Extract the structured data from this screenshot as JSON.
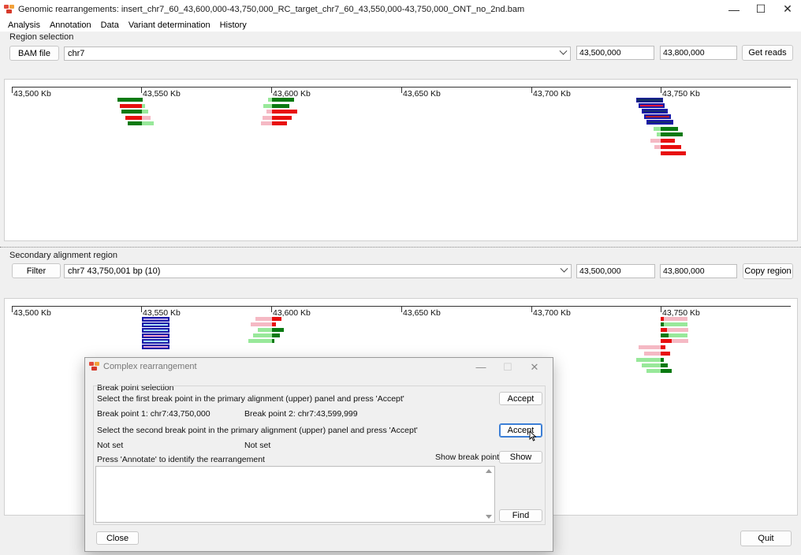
{
  "window": {
    "title": "Genomic rearrangements: insert_chr7_60_43,600,000-43,750,000_RC_target_chr7_60_43,550,000-43,750,000_ONT_no_2nd.bam",
    "minimize": "—",
    "maximize": "☐",
    "close": "✕"
  },
  "menu": [
    "Analysis",
    "Annotation",
    "Data",
    "Variant determination",
    "History"
  ],
  "region_selection": {
    "label": "Region selection",
    "bam_button": "BAM file",
    "chromosome": "chr7",
    "start": "43,500,000",
    "end": "43,800,000",
    "get_reads": "Get reads"
  },
  "primary_panel": {
    "ticks": [
      "43,500 Kb",
      "43,550 Kb",
      "43,600 Kb",
      "43,650 Kb",
      "43,700 Kb",
      "43,750 Kb"
    ]
  },
  "secondary_region": {
    "label": "Secondary alignment region",
    "filter_button": "Filter",
    "selection": "chr7 43,750,001 bp (10)",
    "start": "43,500,000",
    "end": "43,800,000",
    "copy_region": "Copy region"
  },
  "secondary_panel": {
    "ticks": [
      "43,500 Kb",
      "43,550 Kb",
      "43,600 Kb",
      "43,650 Kb",
      "43,700 Kb",
      "43,750 Kb"
    ]
  },
  "quit_button": "Quit",
  "dialog": {
    "title": "Complex rearrangement",
    "group_label": "Break point selection",
    "instruction_first": "Select the first break point in the primary alignment (upper) panel and press 'Accept'",
    "accept_1": "Accept",
    "bp1": "Break point 1: chr7:43,750,000",
    "bp2": "Break point 2: chr7:43,599,999",
    "instruction_second": "Select the second break point in the primary alignment (upper) panel and press 'Accept'",
    "accept_2": "Accept",
    "not_set_1": "Not set",
    "not_set_2": "Not set",
    "annotate_hint": "Press 'Annotate' to identify the rearrangement",
    "show_label": "Show break points",
    "show_button": "Show",
    "find_button": "Find",
    "close_button": "Close",
    "result_text": ""
  }
}
